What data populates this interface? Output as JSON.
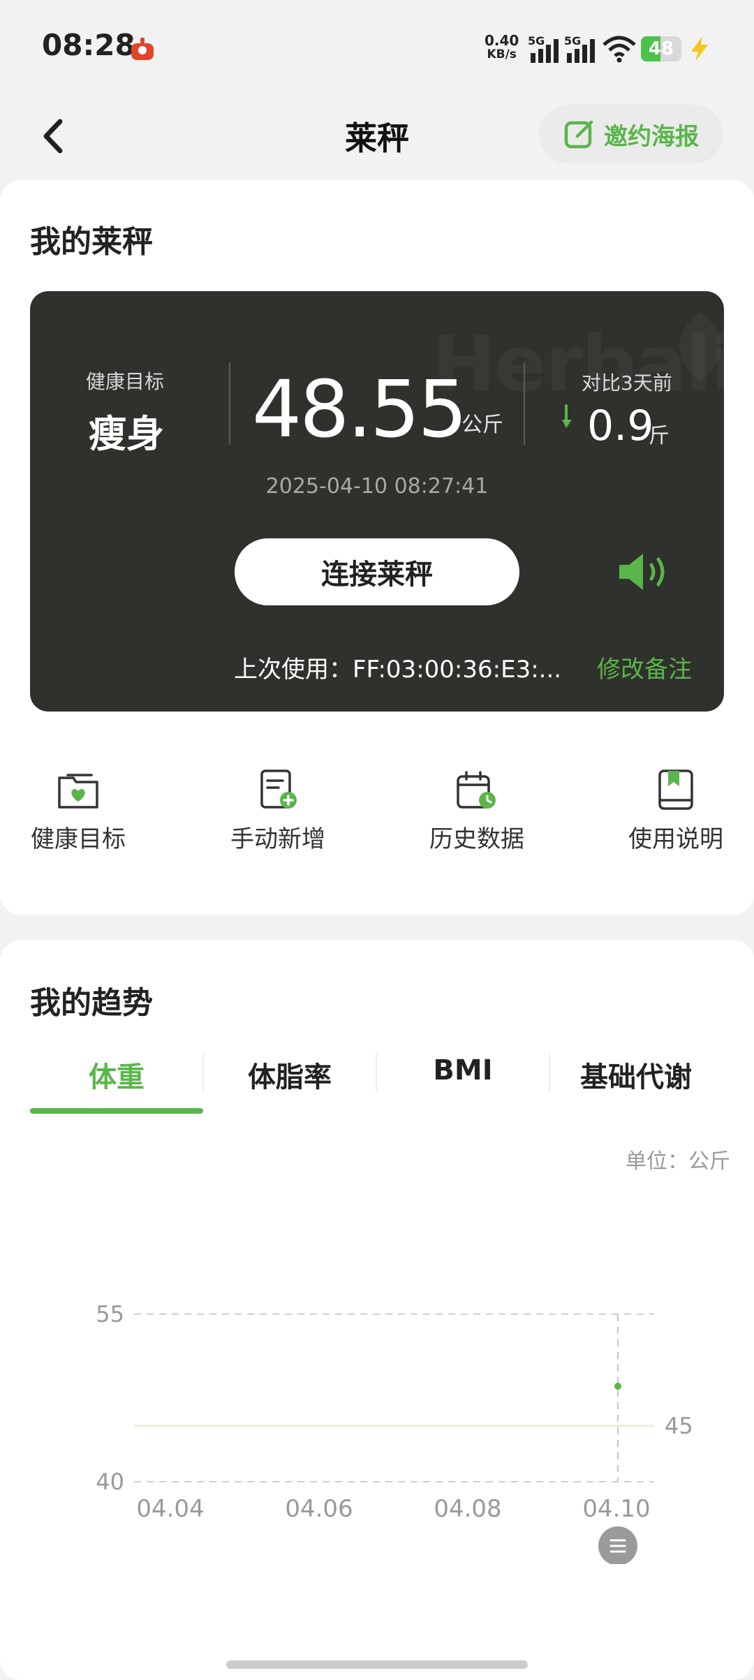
{
  "status_bar": {
    "time": "08:28",
    "net_speed_value": "0.40",
    "net_speed_unit": "KB/s",
    "sig1_label": "5G",
    "sig2_label": "5G",
    "battery_level": "48",
    "battery_fraction": 0.48
  },
  "header": {
    "title": "莱秤",
    "poster_label": "邀约海报"
  },
  "my_scale": {
    "title": "我的莱秤",
    "watermark": "Herbalife",
    "goal_label": "健康目标",
    "goal_value": "瘦身",
    "weight_value": "48.55",
    "weight_unit": "公斤",
    "compare_label": "对比3天前",
    "compare_value": "0.9",
    "compare_unit": "斤",
    "measure_time": "2025-04-10 08:27:41",
    "connect_label": "连接莱秤",
    "last_use": "上次使用：FF:03:00:36:E3:...",
    "edit_note_label": "修改备注"
  },
  "quick_actions": [
    {
      "label": "健康目标",
      "icon": "health-goal-icon"
    },
    {
      "label": "手动新增",
      "icon": "manual-add-icon"
    },
    {
      "label": "历史数据",
      "icon": "history-data-icon"
    },
    {
      "label": "使用说明",
      "icon": "instructions-icon"
    }
  ],
  "trend": {
    "title": "我的趋势",
    "tabs": [
      "体重",
      "体脂率",
      "BMI",
      "基础代谢"
    ],
    "active_tab": 0,
    "unit_label": "单位：公斤"
  },
  "chart_data": {
    "type": "line",
    "x": [
      "04.04",
      "04.06",
      "04.08",
      "04.10"
    ],
    "yticks_left": [
      55,
      40
    ],
    "ylim": [
      40,
      55
    ],
    "ytick_right": 45,
    "series": [
      {
        "values": [
          null,
          null,
          null,
          48.55
        ]
      }
    ],
    "grid": true
  },
  "colors": {
    "accent": "#5ab54a",
    "card_dark": "#2f312c",
    "page_bg": "#f2f2f2"
  }
}
